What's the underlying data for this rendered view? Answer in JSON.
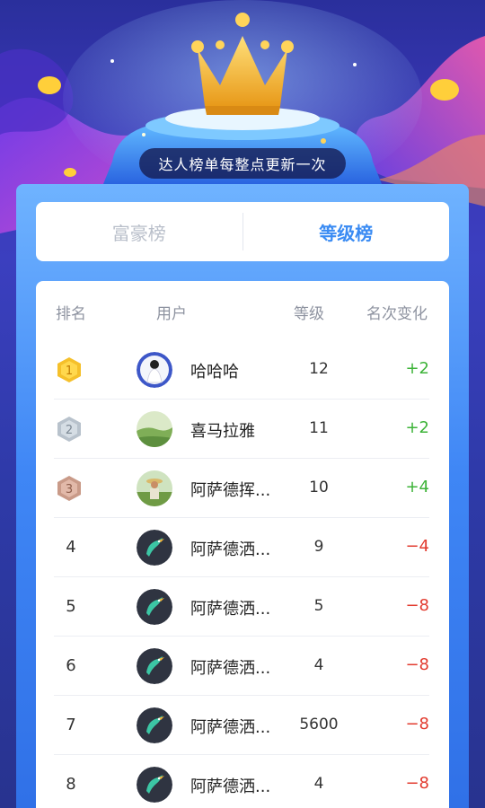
{
  "notice": "达人榜单每整点更新一次",
  "tabs": [
    {
      "label": "富豪榜",
      "active": false
    },
    {
      "label": "等级榜",
      "active": true
    }
  ],
  "table": {
    "headers": {
      "rank": "排名",
      "user": "用户",
      "level": "等级",
      "change": "名次变化"
    },
    "rows": [
      {
        "rank": "1",
        "name": "哈哈哈",
        "level": "12",
        "change": "+2",
        "direction": "up",
        "avatar": "woman-avatar"
      },
      {
        "rank": "2",
        "name": "喜马拉雅",
        "level": "11",
        "change": "+2",
        "direction": "up",
        "avatar": "landscape-avatar"
      },
      {
        "rank": "3",
        "name": "阿萨德挥...",
        "level": "10",
        "change": "+4",
        "direction": "up",
        "avatar": "farmer-avatar"
      },
      {
        "rank": "4",
        "name": "阿萨德洒...",
        "level": "9",
        "change": "−4",
        "direction": "down",
        "avatar": "bird-avatar"
      },
      {
        "rank": "5",
        "name": "阿萨德洒...",
        "level": "5",
        "change": "−8",
        "direction": "down",
        "avatar": "bird-avatar"
      },
      {
        "rank": "6",
        "name": "阿萨德洒...",
        "level": "4",
        "change": "−8",
        "direction": "down",
        "avatar": "bird-avatar"
      },
      {
        "rank": "7",
        "name": "阿萨德洒...",
        "level": "5600",
        "change": "−8",
        "direction": "down",
        "avatar": "bird-avatar"
      },
      {
        "rank": "8",
        "name": "阿萨德洒...",
        "level": "4",
        "change": "−8",
        "direction": "down",
        "avatar": "bird-avatar"
      }
    ]
  },
  "colors": {
    "accent": "#3a8bf3",
    "up": "#3db338",
    "down": "#e23a2e",
    "gold": "#f5c02a",
    "silver": "#b8c2cc",
    "bronze": "#c99a88"
  }
}
